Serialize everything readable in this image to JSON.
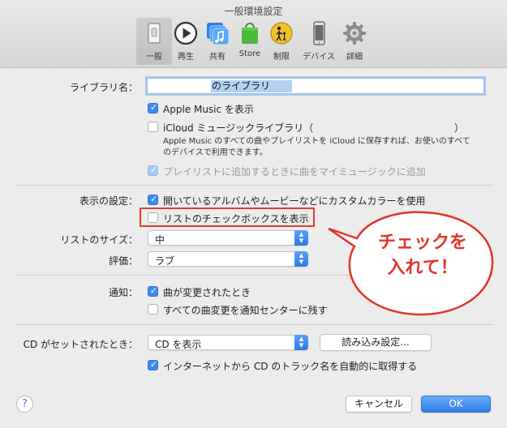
{
  "window": {
    "title": "一般環境設定"
  },
  "toolbar": {
    "items": [
      {
        "label": "一般",
        "icon": "general-switch-icon"
      },
      {
        "label": "再生",
        "icon": "play-icon"
      },
      {
        "label": "共有",
        "icon": "shared-library-icon"
      },
      {
        "label": "Store",
        "icon": "store-bag-icon"
      },
      {
        "label": "制限",
        "icon": "parental-restrictions-icon"
      },
      {
        "label": "デバイス",
        "icon": "device-iphone-icon"
      },
      {
        "label": "詳細",
        "icon": "gear-icon"
      }
    ]
  },
  "library": {
    "label": "ライブラリ名：",
    "value": "のライブラリ",
    "apple_music_label": "Apple Music を表示",
    "icloud_label": "iCloud ミュージックライブラリ（",
    "icloud_close": "）",
    "icloud_note_1": "Apple Music のすべての曲やプレイリストを iCloud に保存すれば、お使いのすべて",
    "icloud_note_2": "のデバイスで利用できます。",
    "playlist_add_label": "プレイリストに追加するときに曲をマイミュージックに追加"
  },
  "display": {
    "label": "表示の設定：",
    "custom_color_label": "開いているアルバムやムービーなどにカスタムカラーを使用",
    "list_checkbox_label": "リストのチェックボックスを表示",
    "list_size_label": "リストのサイズ：",
    "list_size_value": "中",
    "rating_label": "評価：",
    "rating_value": "ラブ"
  },
  "notifications": {
    "label": "通知：",
    "song_change_label": "曲が変更されたとき",
    "all_changes_label": "すべての曲変更を通知センターに残す"
  },
  "cd": {
    "label": "CD がセットされたとき：",
    "action_value": "CD を表示",
    "import_settings_label": "読み込み設定...",
    "auto_fetch_label": "インターネットから CD のトラック名を自動的に取得する"
  },
  "footer": {
    "help_label": "?",
    "cancel_label": "キャンセル",
    "ok_label": "OK"
  },
  "annotation": {
    "line1": "チェックを",
    "line2": "入れて！"
  },
  "colors": {
    "accent": "#3e8bf0",
    "annotation_red": "#e0352a"
  }
}
